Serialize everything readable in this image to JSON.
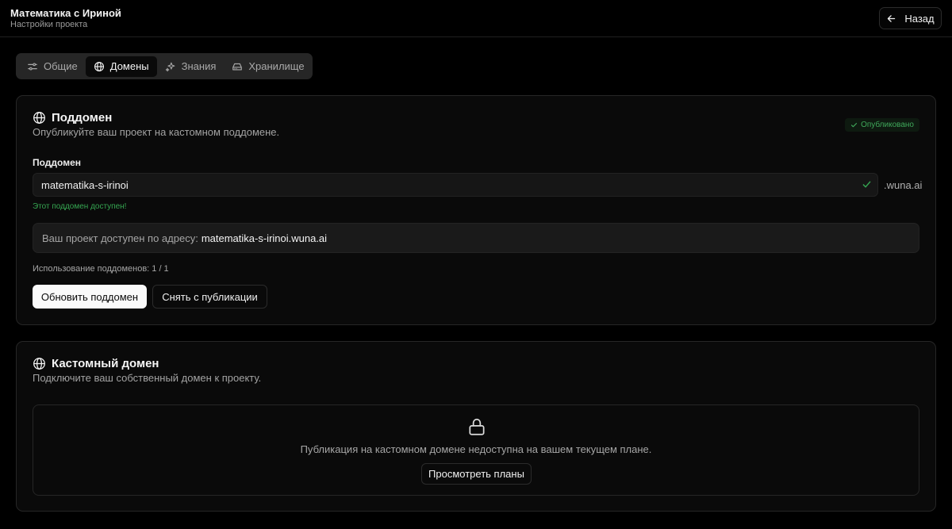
{
  "header": {
    "title": "Математика с Ириной",
    "subtitle": "Настройки проекта",
    "back_label": "Назад"
  },
  "tabs": [
    {
      "label": "Общие",
      "icon": "sliders-icon",
      "active": false
    },
    {
      "label": "Домены",
      "icon": "globe-icon",
      "active": true
    },
    {
      "label": "Знания",
      "icon": "sparkles-icon",
      "active": false
    },
    {
      "label": "Хранилище",
      "icon": "hard-drive-icon",
      "active": false
    }
  ],
  "subdomain_card": {
    "title": "Поддомен",
    "description": "Опубликуйте ваш проект на кастомном поддомене.",
    "badge": "Опубликовано",
    "field_label": "Поддомен",
    "input_value": "matematika-s-irinoi",
    "suffix": ".wuna.ai",
    "available_msg": "Этот поддомен доступен!",
    "address_label": "Ваш проект доступен по адресу:",
    "address_url": "matematika-s-irinoi.wuna.ai",
    "usage": "Использование поддоменов: 1 / 1",
    "update_button": "Обновить поддомен",
    "unpublish_button": "Снять с публикации"
  },
  "custom_domain_card": {
    "title": "Кастомный домен",
    "description": "Подключите ваш собственный домен к проекту.",
    "locked_message": "Публикация на кастомном домене недоступна на вашем текущем плане.",
    "plans_button": "Просмотреть планы"
  },
  "colors": {
    "background": "#000000",
    "card": "#0a0a0a",
    "success": "#35a651",
    "primary_button": "#fafafa"
  }
}
